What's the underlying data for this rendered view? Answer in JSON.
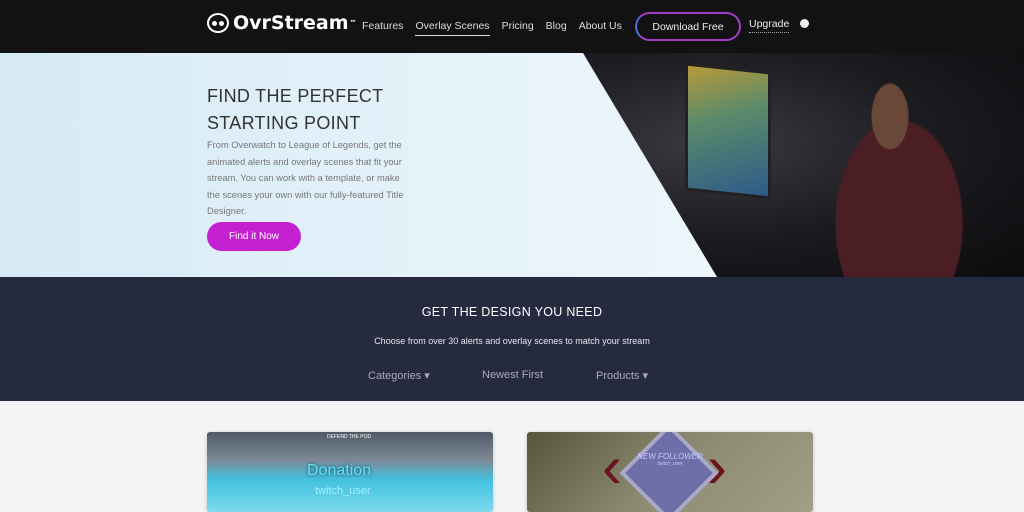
{
  "nav": {
    "brand": "OvrStream",
    "tm": "™",
    "links": [
      {
        "label": "Features"
      },
      {
        "label": "Overlay Scenes",
        "active": true
      },
      {
        "label": "Pricing"
      },
      {
        "label": "Blog"
      },
      {
        "label": "About Us"
      }
    ],
    "download": "Download Free",
    "upgrade": "Upgrade",
    "user_icon": "user-circle-icon"
  },
  "hero": {
    "title_line1": "FIND THE PERFECT",
    "title_line2": "STARTING POINT",
    "description": "From Overwatch to League of Legends, get the animated alerts and overlay scenes that fit your stream. You can work with a template, or make the scenes your own with our fully-featured Title Designer.",
    "cta": "Find it Now",
    "cta_color": "#c41fd0"
  },
  "band": {
    "title": "GET THE DESIGN YOU NEED",
    "subtitle": "Choose from over 30 alerts and overlay scenes to match your stream",
    "filters": [
      "Categories ▾",
      "Newest First",
      "Products ▾"
    ]
  },
  "cards": [
    {
      "overlay_title": "Donation",
      "overlay_user": "twitch_user",
      "overlay_tag": "DEFEND THE POD"
    },
    {
      "overlay_title": "NEW FOLLOWER",
      "overlay_user": "twitch_user"
    }
  ]
}
